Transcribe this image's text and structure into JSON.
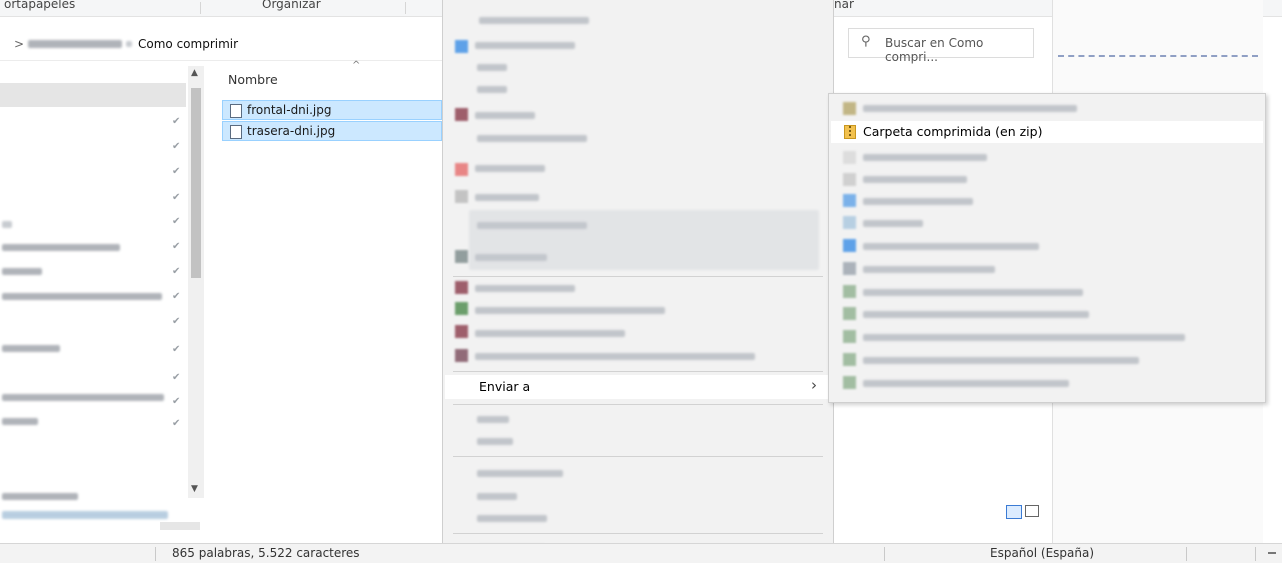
{
  "explorer": {
    "ribbon_portapapeles": "ortapapeles",
    "ribbon_organizar": "Organizar",
    "breadcrumb_sep": ">",
    "breadcrumb_current": "Como comprimir",
    "column_nombre": "Nombre",
    "files": [
      {
        "name": "frontal-dni.jpg"
      },
      {
        "name": "trasera-dni.jpg"
      }
    ],
    "search_placeholder": "Buscar en Como compri...",
    "ribbon_right": "nar"
  },
  "context_menu": {
    "enviar_a": "Enviar a"
  },
  "submenu": {
    "compressed_folder": "Carpeta comprimida (en zip)"
  },
  "statusbar": {
    "word_count": "865 palabras, 5.522 caracteres",
    "language": "Español (España)"
  },
  "colors": {
    "selection": "#cce8ff",
    "selection_border": "#99d1ff",
    "menu_bg": "#f2f2f2",
    "hover": "#ffffff",
    "zip_yellow": "#f2c14e"
  }
}
